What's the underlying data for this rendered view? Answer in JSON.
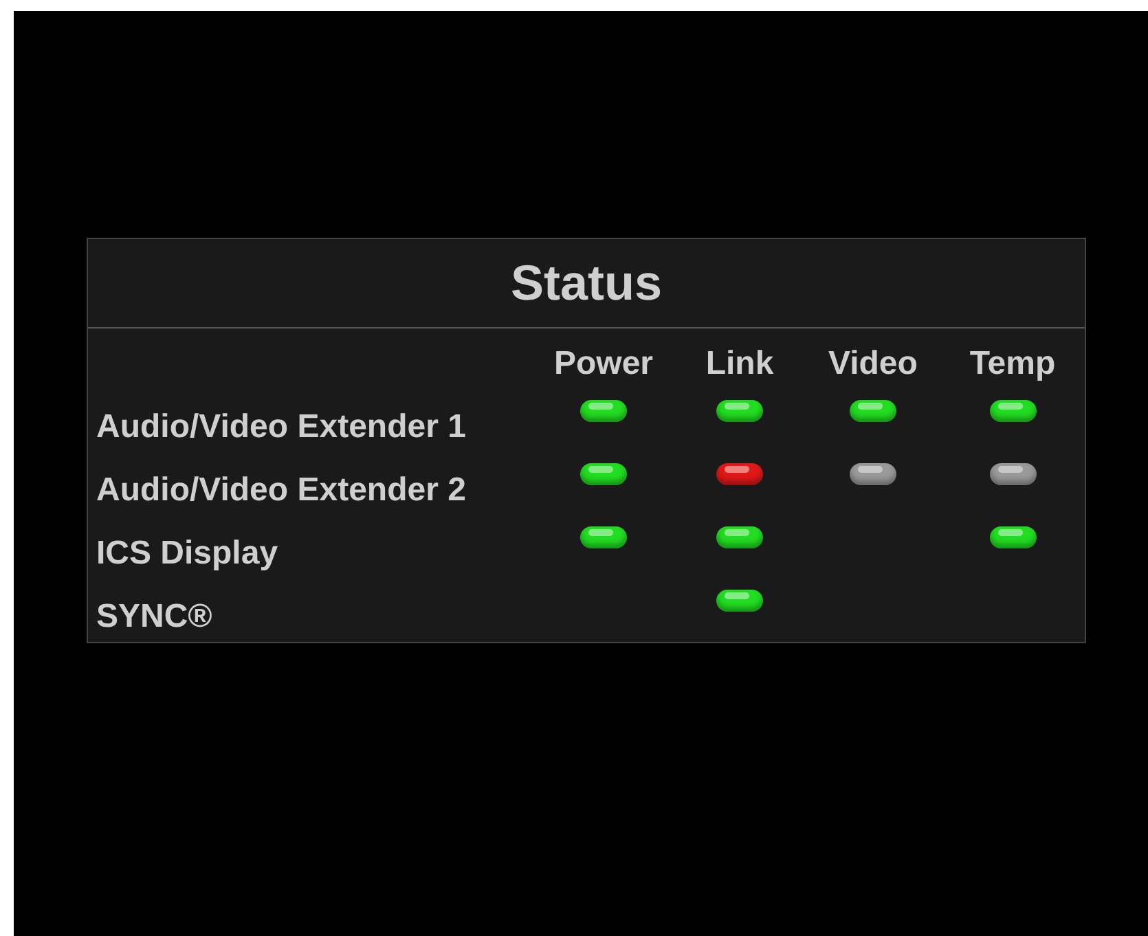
{
  "panel": {
    "title": "Status",
    "columns": [
      "Power",
      "Link",
      "Video",
      "Temp"
    ],
    "rows": [
      {
        "name": "Audio/Video Extender 1",
        "indicators": [
          {
            "kind": "led",
            "color": "#22dd22"
          },
          {
            "kind": "led",
            "color": "#22dd22"
          },
          {
            "kind": "led",
            "color": "#22dd22"
          },
          {
            "kind": "led",
            "color": "#22dd22"
          }
        ]
      },
      {
        "name": "Audio/Video Extender 2",
        "indicators": [
          {
            "kind": "led",
            "color": "#22dd22"
          },
          {
            "kind": "led",
            "color": "#e01818"
          },
          {
            "kind": "led",
            "color": "#9a9a9a"
          },
          {
            "kind": "led",
            "color": "#9a9a9a"
          }
        ]
      },
      {
        "name": "ICS Display",
        "indicators": [
          {
            "kind": "led",
            "color": "#22dd22"
          },
          {
            "kind": "led",
            "color": "#22dd22"
          },
          {
            "kind": "empty"
          },
          {
            "kind": "led",
            "color": "#22dd22"
          }
        ]
      },
      {
        "name": "SYNC®",
        "indicators": [
          {
            "kind": "empty"
          },
          {
            "kind": "led",
            "color": "#22dd22"
          },
          {
            "kind": "empty"
          },
          {
            "kind": "empty"
          }
        ]
      }
    ]
  }
}
